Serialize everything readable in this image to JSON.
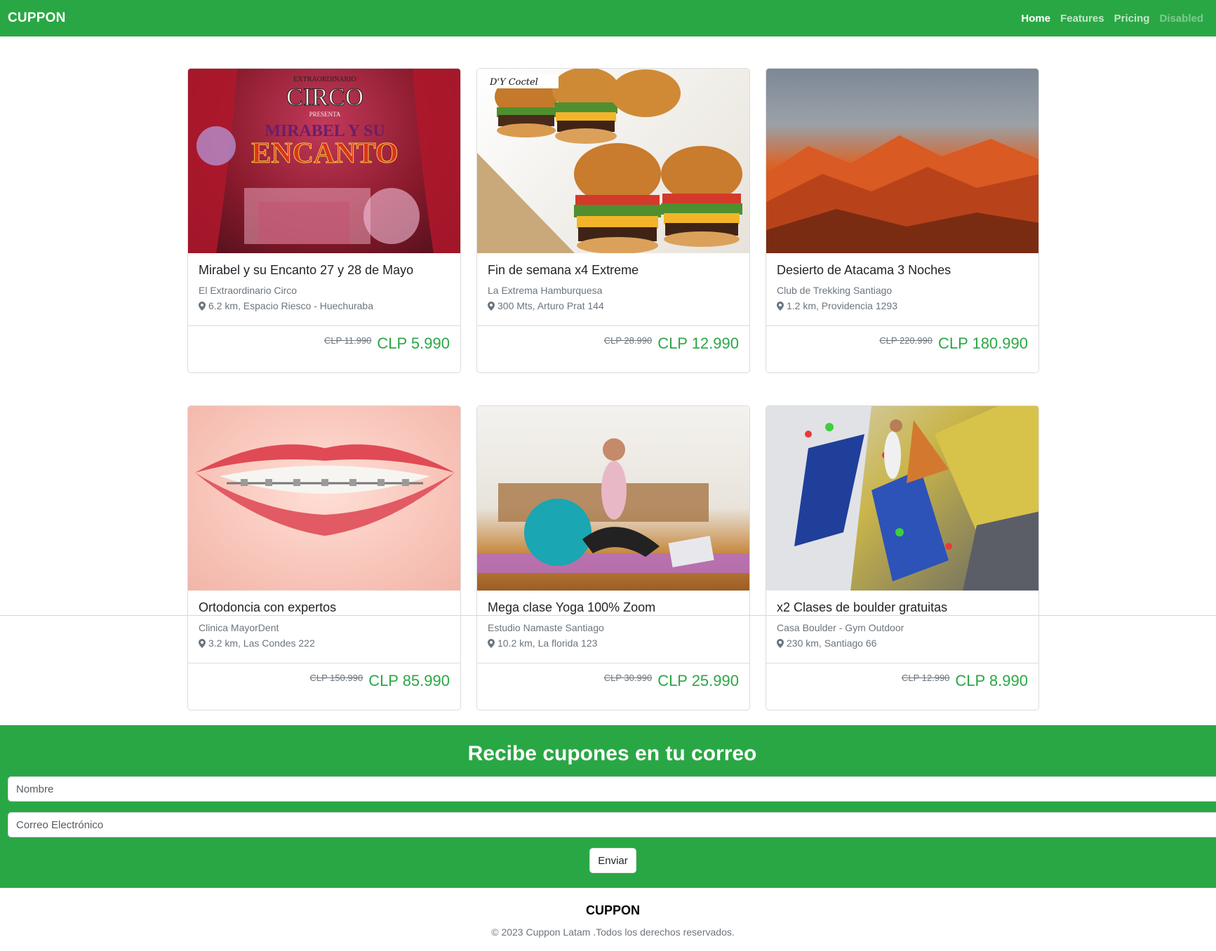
{
  "navbar": {
    "brand": "CUPPON",
    "links": [
      "Home",
      "Features",
      "Pricing",
      "Disabled"
    ]
  },
  "cards": [
    {
      "title": "Mirabel y su Encanto 27 y 28 de Mayo",
      "vendor": "El Extraordinario Circo",
      "location": "6.2 km, Espacio Riesco - Huechuraba",
      "old_price": "CLP 11.990",
      "price": "CLP 5.990",
      "image_text": [
        "EXTRAORDINARIO",
        "CIRCO",
        "PRESENTA",
        "MIRABEL Y SU",
        "ENCANTO"
      ]
    },
    {
      "title": "Fin de semana x4 Extreme",
      "vendor": "La Extrema Hamburquesa",
      "location": "300 Mts, Arturo Prat 144",
      "old_price": "CLP 28.990",
      "price": "CLP 12.990",
      "image_text": [
        "D'Y Coctel"
      ]
    },
    {
      "title": "Desierto de Atacama 3 Noches",
      "vendor": "Club de Trekking Santiago",
      "location": "1.2 km, Providencia 1293",
      "old_price": "CLP 220.990",
      "price": "CLP 180.990"
    },
    {
      "title": "Ortodoncia con expertos",
      "vendor": "Clinica MayorDent",
      "location": "3.2 km, Las Condes 222",
      "old_price": "CLP 150.990",
      "price": "CLP 85.990"
    },
    {
      "title": "Mega clase Yoga 100% Zoom",
      "vendor": "Estudio Namaste Santiago",
      "location": "10.2 km, La florida 123",
      "old_price": "CLP 30.990",
      "price": "CLP 25.990"
    },
    {
      "title": "x2 Clases de boulder gratuitas",
      "vendor": "Casa Boulder - Gym Outdoor",
      "location": "230 km, Santiago 66",
      "old_price": "CLP 12.990",
      "price": "CLP 8.990"
    }
  ],
  "newsletter": {
    "title": "Recibe cupones en tu correo",
    "name_placeholder": "Nombre",
    "email_placeholder": "Correo Electrónico",
    "submit_label": "Enviar"
  },
  "footer": {
    "brand": "CUPPON",
    "copyright": "© 2023 Cuppon Latam .Todos los derechos reservados."
  },
  "colors": {
    "brand_green": "#2aa745",
    "price_green": "#2aa745",
    "muted_text": "#6c757d"
  },
  "icons": [
    "map-pin-icon"
  ]
}
